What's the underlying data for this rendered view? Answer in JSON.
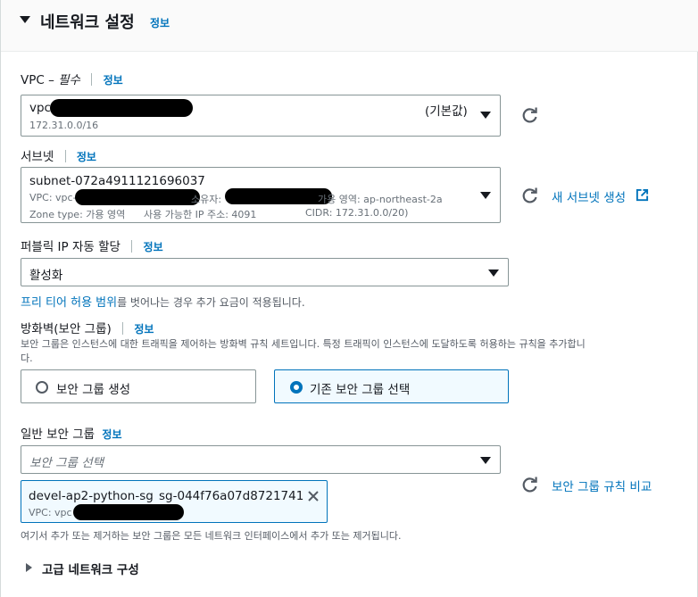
{
  "section": {
    "title": "네트워크 설정",
    "info": "정보"
  },
  "vpc": {
    "label": "VPC –",
    "required": "필수",
    "info": "정보",
    "value_prefix": "vpc",
    "default_tag": "(기본값)",
    "cidr": "172.31.0.0/16"
  },
  "subnet": {
    "label": "서브넷",
    "info": "정보",
    "value": "subnet-072a4911121696037",
    "vpc_prefix": "VPC: vpc-",
    "owner_label": "소유자:",
    "az": "가용 영역: ap-northeast-2a",
    "zone_type": "Zone type: 가용 영역",
    "available_ip": "사용 가능한 IP 주소: 4091",
    "cidr": "CIDR: 172.31.0.0/20)",
    "create_link": "새 서브넷 생성"
  },
  "public_ip": {
    "label": "퍼블릭 IP 자동 할당",
    "info": "정보",
    "value": "활성화",
    "free_tier_link": "프리 티어 허용 범위",
    "free_tier_text": "를 벗어나는 경우 추가 요금이 적용됩니다."
  },
  "firewall": {
    "label": "방화벽(보안 그룹)",
    "info": "정보",
    "description_line1": "보안 그룹은 인스턴스에 대한 트래픽을 제어하는 방화벽 규칙 세트입니다. 특정 트래픽이 인스턴스에 도달하도록 허용하는 규칙을 추가합니",
    "description_line2": "다.",
    "option_create": "보안 그룹 생성",
    "option_existing": "기존 보안 그룹 선택"
  },
  "security_group": {
    "label": "일반 보안 그룹",
    "info": "정보",
    "placeholder": "보안 그룹 선택",
    "token_name": "devel-ap2-python-sg",
    "token_id": "sg-044f76a07d8721741",
    "token_vpc": "VPC: vpc",
    "compare_link": "보안 그룹 규칙 비교",
    "note": "여기서 추가 또는 제거하는 보안 그룹은 모든 네트워크 인터페이스에서 추가 또는 제거됩니다."
  },
  "advanced": {
    "label": "고급 네트워크 구성"
  },
  "colors": {
    "link": "#0073bb",
    "text": "#16191f",
    "muted": "#687078",
    "border": "#879596"
  }
}
